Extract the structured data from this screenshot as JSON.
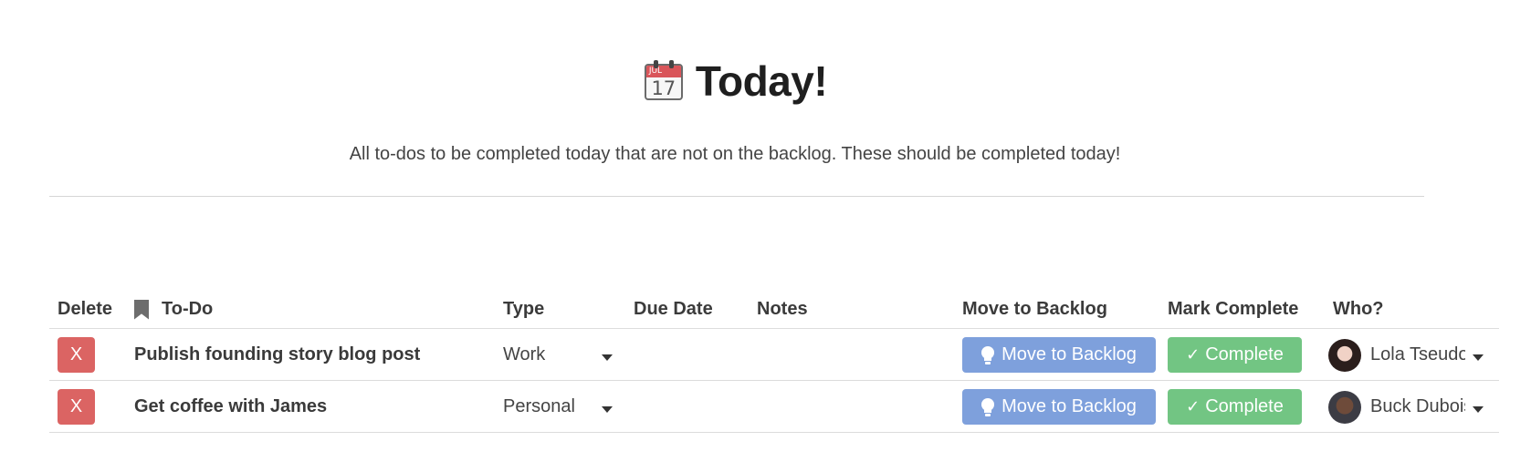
{
  "header": {
    "calendar_icon": {
      "month": "JUL",
      "day": "17"
    },
    "title": "Today!",
    "subtitle": "All to-dos to be completed today that are not on the backlog. These should be completed today!"
  },
  "table": {
    "columns": {
      "delete": "Delete",
      "todo": "To-Do",
      "type": "Type",
      "due_date": "Due Date",
      "notes": "Notes",
      "move_to_backlog": "Move to Backlog",
      "mark_complete": "Mark Complete",
      "who": "Who?"
    },
    "rows": [
      {
        "delete_label": "X",
        "todo": "Publish founding story blog post",
        "type": "Work",
        "due_date": "",
        "notes": "",
        "backlog_label": "Move to Backlog",
        "complete_label": "Complete",
        "who": "Lola Tseudonym"
      },
      {
        "delete_label": "X",
        "todo": "Get coffee with James",
        "type": "Personal",
        "due_date": "",
        "notes": "",
        "backlog_label": "Move to Backlog",
        "complete_label": "Complete",
        "who": "Buck Duboise"
      }
    ]
  },
  "colors": {
    "delete": "#db6463",
    "backlog": "#7ea0dc",
    "complete": "#72c583",
    "calendar_red": "#d9555a"
  },
  "icons": {
    "title": "calendar-icon",
    "todo_column": "bookmark-icon",
    "backlog_button": "lightbulb-icon",
    "complete_button": "check-icon"
  }
}
